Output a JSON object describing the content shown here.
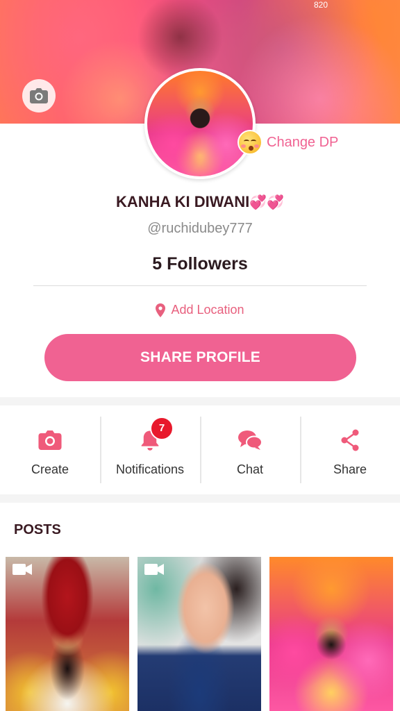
{
  "status_bar": {
    "time": "820"
  },
  "cover": {
    "camera_icon": "camera-icon"
  },
  "profile": {
    "change_dp_label": "Change DP",
    "name": "KANHA KI DIWANI",
    "name_emoji": "💞💞",
    "handle": "@ruchidubey777",
    "followers": "5 Followers",
    "location_label": "Add Location",
    "share_button": "SHARE PROFILE"
  },
  "actions": [
    {
      "label": "Create",
      "icon": "camera-icon"
    },
    {
      "label": "Notifications",
      "icon": "bell-icon",
      "badge": "7"
    },
    {
      "label": "Chat",
      "icon": "chat-icon"
    },
    {
      "label": "Share",
      "icon": "share-icon"
    }
  ],
  "posts": {
    "title": "POSTS",
    "items": [
      {
        "type": "video",
        "icon": "video-icon"
      },
      {
        "type": "video",
        "icon": "video-icon"
      },
      {
        "type": "image"
      }
    ]
  },
  "colors": {
    "accent": "#f06292",
    "badge": "#e8192c",
    "text_dark": "#3a1a22"
  }
}
